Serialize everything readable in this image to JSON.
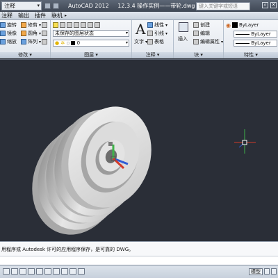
{
  "titlebar": {
    "workspace": "注释",
    "app_name": "AutoCAD 2012",
    "file_title": "12.3.4 操作实例——带轮.dwg",
    "search_placeholder": "键入关键字或短语"
  },
  "tabs": [
    "注释",
    "输出",
    "插件",
    "联机"
  ],
  "ribbon": {
    "modify": {
      "title": "修改",
      "rotate": "旋转",
      "trim": "修剪",
      "mirror": "镜像",
      "fillet": "圆角",
      "scale": "缩放",
      "array": "阵列"
    },
    "layers": {
      "title": "图层",
      "unsaved_state": "未保存的图层状态",
      "current_layer": "0"
    },
    "annotation": {
      "title": "注释",
      "text": "文字",
      "linear": "线性",
      "leader": "引线",
      "table": "表格"
    },
    "block": {
      "title": "块",
      "insert": "插入",
      "create": "创建",
      "edit": "编辑",
      "edit_attrs": "编辑属性"
    },
    "properties": {
      "title": "特性",
      "color": "ByLayer",
      "linetype": "ByLayer",
      "lineweight": "ByLayer"
    }
  },
  "command_line": {
    "history": "用程序或 Autodesk 许可的应用程序保存，是可靠的 DWG。",
    "input": ""
  },
  "status": {
    "model": "模型"
  },
  "colors": {
    "canvas": "#2a2e37",
    "ucs_x": "#d23a2a",
    "ucs_y": "#3fb34a",
    "ucs_z": "#2f5bd6",
    "pulley": "#d9d9d9"
  }
}
